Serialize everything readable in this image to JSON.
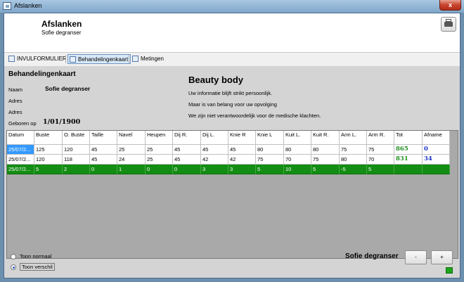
{
  "window": {
    "title": "Afslanken",
    "close_label": "x"
  },
  "header": {
    "title": "Afslanken",
    "subtitle": "Sofie degranser"
  },
  "toolbar": {
    "items": [
      "INVULFORMULIER",
      "Behandelingenkaart",
      "Metingen"
    ],
    "active_index": 1
  },
  "info": {
    "section_title": "Behandelingenkaart",
    "labels": {
      "naam": "Naam",
      "adres1": "Adres",
      "adres2": "Adres",
      "geboren": "Geboren op"
    },
    "values": {
      "naam": "Sofie degranser",
      "geboren": "1/01/1900"
    }
  },
  "beauty": {
    "title": "Beauty body",
    "lines": [
      "Uw informatie blijft strikt persoonlijk.",
      "Maar is van belang voor uw opvolging",
      "We zijn niet verantwoordelijk voor de medische klachten."
    ]
  },
  "table": {
    "columns": [
      "Datum",
      "Buste",
      "O. Buste",
      "Taille",
      "Navel",
      "Heupen",
      "Dij R.",
      "Dij L.",
      "Knie R",
      "Knie L",
      "Kuit L.",
      "Kuit R.",
      "Arm L.",
      "Arm R.",
      "Tot",
      "Afname"
    ],
    "rows": [
      [
        "25/07/2...",
        "125",
        "120",
        "45",
        "25",
        "25",
        "45",
        "45",
        "45",
        "80",
        "80",
        "80",
        "75",
        "75",
        "865",
        "0"
      ],
      [
        "25/07/2...",
        "120",
        "118",
        "45",
        "24",
        "25",
        "45",
        "42",
        "42",
        "75",
        "70",
        "75",
        "80",
        "70",
        "831",
        "34"
      ],
      [
        "25/07/2...",
        "5",
        "2",
        "0",
        "1",
        "0",
        "0",
        "3",
        "3",
        "5",
        "10",
        "5",
        "-5",
        "5",
        "",
        ""
      ]
    ]
  },
  "footer": {
    "radio": [
      "Toon normaal",
      "Toon verschil"
    ],
    "selected_radio": 1,
    "name": "Sofie degranser",
    "prev_label": "-",
    "next_label": "+"
  },
  "colors": {
    "diff_row": "#138d13",
    "selection": "#3399ff",
    "total": "#1f8f1f",
    "afname": "#1a32c9"
  }
}
